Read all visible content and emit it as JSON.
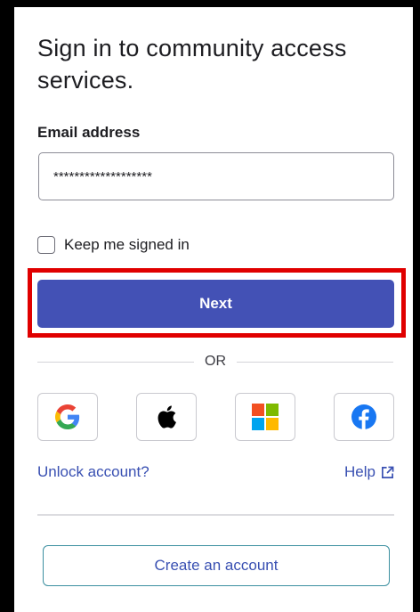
{
  "title": "Sign in to community access services.",
  "email": {
    "label": "Email address",
    "value": "*******************"
  },
  "keep_signed_in": {
    "label": "Keep me signed in",
    "checked": false
  },
  "next_button": "Next",
  "divider_text": "OR",
  "identity_providers": [
    {
      "name": "google-icon"
    },
    {
      "name": "apple-icon"
    },
    {
      "name": "microsoft-icon"
    },
    {
      "name": "facebook-icon"
    }
  ],
  "links": {
    "unlock": "Unlock account?",
    "help": "Help"
  },
  "create_account": "Create an account",
  "colors": {
    "primary": "#4351b5",
    "link": "#3950b2",
    "highlight": "#e00000"
  }
}
